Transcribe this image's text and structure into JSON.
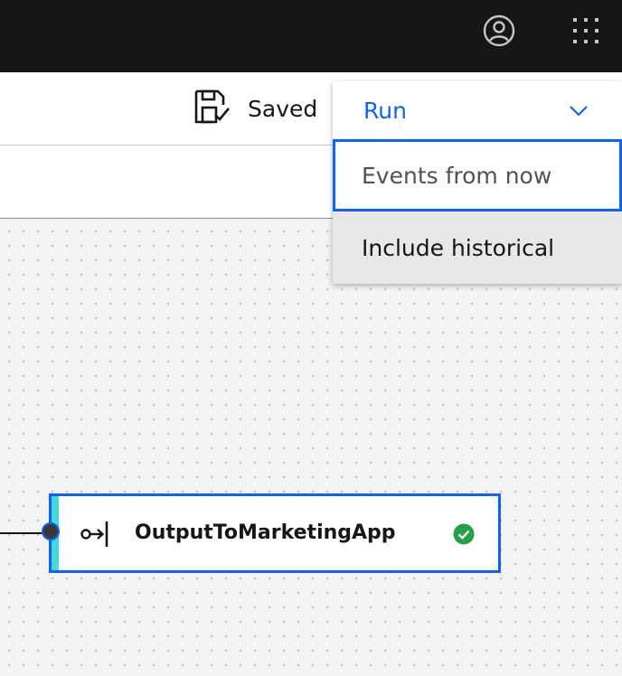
{
  "header": {
    "user_icon": "user-avatar-icon",
    "switcher_icon": "app-switcher-icon"
  },
  "toolbar": {
    "save_icon": "save-check-icon",
    "save_status": "Saved"
  },
  "run_menu": {
    "label": "Run",
    "options": [
      {
        "label": "Events from now",
        "state": "focused"
      },
      {
        "label": "Include historical",
        "state": "hover"
      }
    ],
    "accent": "#0f62fe"
  },
  "flow": {
    "node": {
      "title": "OutputToMarketingApp",
      "type_icon": "output-icon",
      "status_icon": "checkmark-filled-icon",
      "status_color": "#24a148",
      "stripe_color": "#3ddbd9"
    }
  }
}
